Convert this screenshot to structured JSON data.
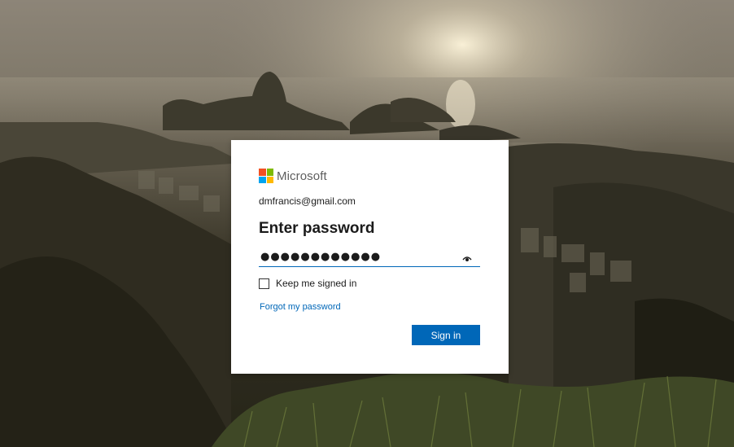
{
  "brand": {
    "name": "Microsoft",
    "logo_colors": [
      "#f25022",
      "#7fba00",
      "#00a4ef",
      "#ffb900"
    ]
  },
  "account": {
    "email": "dmfrancis@gmail.com"
  },
  "form": {
    "title": "Enter password",
    "password_value": "●●●●●●●●●●●●",
    "reveal_icon": "eye-icon",
    "keep_signed_in_label": "Keep me signed in",
    "keep_signed_in_checked": false,
    "forgot_link": "Forgot my password",
    "submit_label": "Sign in"
  },
  "colors": {
    "accent": "#0067b8",
    "card": "#ffffff"
  }
}
